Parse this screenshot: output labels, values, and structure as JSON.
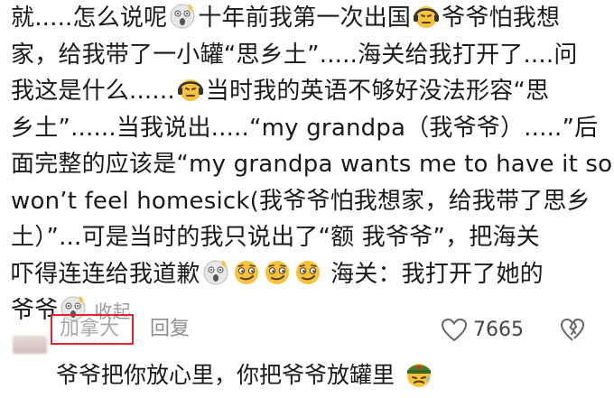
{
  "comment": {
    "lines": [
      [
        "就.....怎么说呢",
        "emoji:shocked",
        "十年前我第一次出国",
        "emoji:awkward",
        "爷爷怕我想"
      ],
      [
        "家，给我带了一小罐“思乡土”.....海关给我打开了....问"
      ],
      [
        "我这是什么......",
        "emoji:awkward",
        "当时我的英语不够好没法形容“思"
      ],
      [
        "乡土”......当我说出.....“my grandpa（我爷爷）.....”后"
      ],
      [
        "面完整的应该是“my grandpa wants me to have it so I"
      ],
      [
        "won’t feel homesick(我爷爷怕我想家，给我带了思乡"
      ],
      [
        "土）”...可是当时的我只说出了“额 我爷爷”，把海关"
      ],
      [
        "吓得连连给我道歉",
        "emoji:shocked",
        "emoji:smirk",
        "emoji:smirk",
        "emoji:smirk",
        " 海关：我打开了她的"
      ],
      [
        "爷爷",
        "emoji:shocked",
        "collapse"
      ]
    ],
    "collapse_label": "收起"
  },
  "actions": {
    "location": "加拿大",
    "reply_label": "回复",
    "like_count": "7665"
  },
  "reply": {
    "text": "爷爷把你放心里，你把爷爷放罐里",
    "emoji": "soldier-sweat-emoji"
  },
  "icons": {
    "shocked": "shocked-face-emoji",
    "awkward": "awkward-headphones-emoji",
    "smirk": "smirk-face-emoji",
    "like": "heart-outline-icon",
    "dislike": "broken-heart-icon"
  },
  "colors": {
    "text": "#1a1a1a",
    "muted": "#9a9a9a",
    "highlight_box": "#e0262b",
    "emoji_yellow": "#f5c33b"
  }
}
